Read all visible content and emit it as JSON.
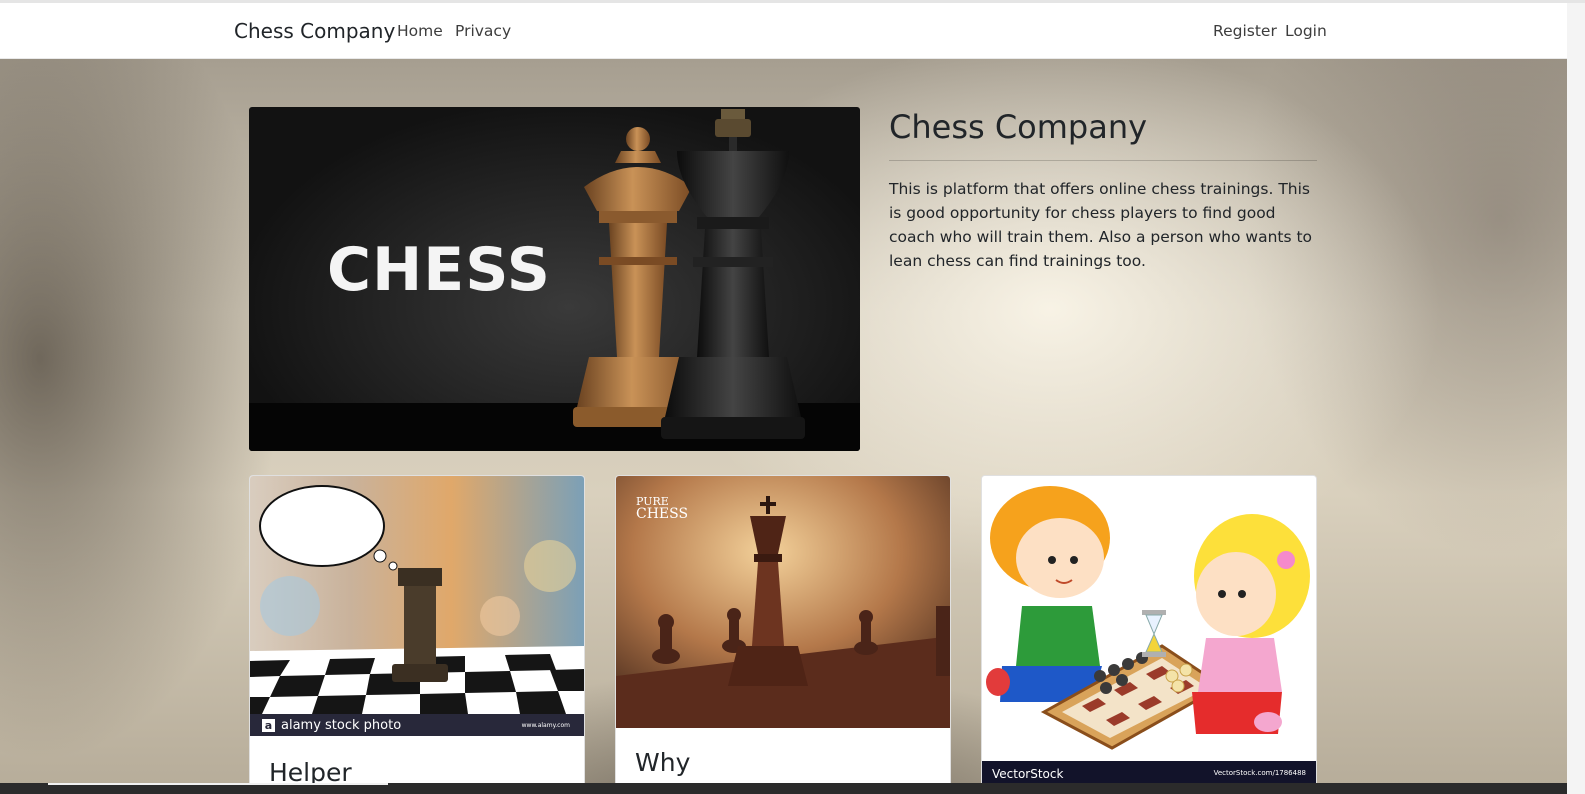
{
  "nav": {
    "brand": "Chess Company",
    "links": [
      "Home",
      "Privacy"
    ],
    "right_links": [
      "Register",
      "Login"
    ]
  },
  "hero": {
    "image_text": "CHESS",
    "title": "Chess Company",
    "description": "This is platform that offers online chess trainings. This is good opportunity for chess players to find good coach who will train them. Also a person who wants to lean chess can find trainings too."
  },
  "cards": [
    {
      "title": "Helper",
      "watermark": "alamy stock photo",
      "watermark_url": "www.alamy.com"
    },
    {
      "title": "Why",
      "logo_line1": "PURE",
      "logo_line2": "CHESS"
    },
    {
      "title": "",
      "watermark_left": "VectorStock",
      "watermark_right": "VectorStock.com/1786488"
    }
  ],
  "colors": {
    "navbar_bg": "#ffffff",
    "text": "#212529",
    "link": "#3d3d3d"
  }
}
